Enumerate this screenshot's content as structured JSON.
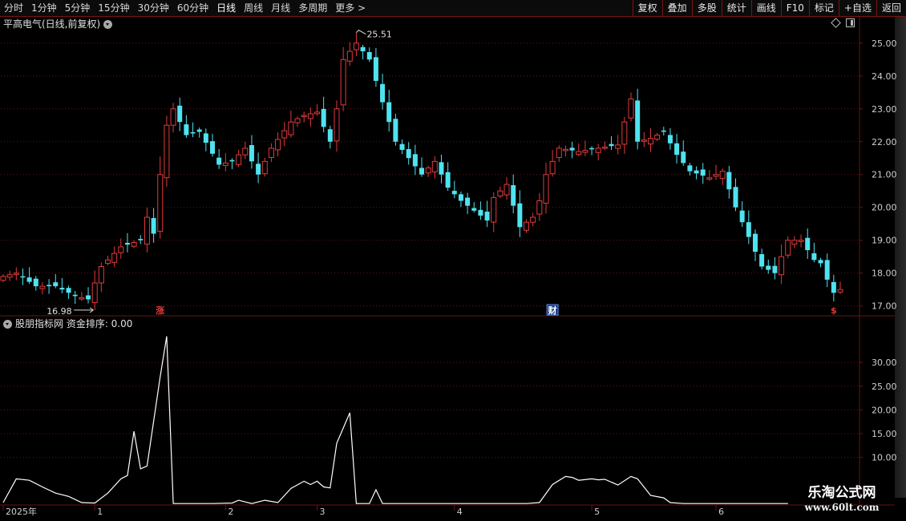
{
  "toolbar": {
    "periods": [
      "分时",
      "1分钟",
      "5分钟",
      "15分钟",
      "30分钟",
      "60分钟",
      "日线",
      "周线",
      "月线",
      "多周期",
      "更多 >"
    ],
    "active_period": "日线",
    "buttons": [
      "复权",
      "叠加",
      "多股",
      "统计",
      "画线",
      "F10",
      "标记",
      "+自选",
      "返回"
    ]
  },
  "stock": {
    "title": "平高电气(日线,前复权)"
  },
  "indicator": {
    "title": "股朋指标网 资金排序: 0.00"
  },
  "watermark": {
    "title": "乐淘公式网",
    "url": "www.60lt.com"
  },
  "colors": {
    "up": "#e23a3a",
    "down": "#4fe3f0",
    "grid": "#6a1414",
    "text": "#cfcfcf",
    "line": "#ffffff"
  },
  "chart_data": [
    {
      "type": "candlestick",
      "ylim": [
        16.7,
        25.8
      ],
      "price_ticks": [
        "25.00",
        "24.00",
        "23.00",
        "22.00",
        "21.00",
        "20.00",
        "19.00",
        "18.00",
        "17.00"
      ],
      "high_label": "25.51",
      "low_label": "16.98",
      "markers": [
        {
          "label": "涨",
          "index": 24
        },
        {
          "label": "财",
          "index": 84
        },
        {
          "label": "$",
          "index": 127
        }
      ],
      "anchors": [
        [
          0,
          17.9
        ],
        [
          2,
          18.0
        ],
        [
          5,
          17.6
        ],
        [
          8,
          17.6
        ],
        [
          11,
          17.3
        ],
        [
          13,
          17.2
        ],
        [
          15,
          18.2
        ],
        [
          18,
          18.8
        ],
        [
          21,
          19.0
        ],
        [
          22,
          19.7
        ],
        [
          23,
          19.2
        ],
        [
          24,
          21.0
        ],
        [
          25,
          22.5
        ],
        [
          26,
          23.0
        ],
        [
          28,
          22.2
        ],
        [
          30,
          22.3
        ],
        [
          33,
          21.3
        ],
        [
          35,
          21.4
        ],
        [
          37,
          21.8
        ],
        [
          39,
          21.0
        ],
        [
          41,
          21.8
        ],
        [
          44,
          22.6
        ],
        [
          46,
          22.8
        ],
        [
          48,
          22.9
        ],
        [
          50,
          22.0
        ],
        [
          51,
          23.0
        ],
        [
          52,
          24.5
        ],
        [
          54,
          25.0
        ],
        [
          56,
          24.5
        ],
        [
          58,
          23.2
        ],
        [
          60,
          22.0
        ],
        [
          62,
          21.5
        ],
        [
          64,
          21.0
        ],
        [
          66,
          21.4
        ],
        [
          68,
          20.6
        ],
        [
          70,
          20.2
        ],
        [
          72,
          19.9
        ],
        [
          74,
          19.6
        ],
        [
          75,
          20.3
        ],
        [
          77,
          20.7
        ],
        [
          79,
          19.4
        ],
        [
          81,
          19.7
        ],
        [
          82,
          20.2
        ],
        [
          83,
          21.0
        ],
        [
          85,
          21.8
        ],
        [
          88,
          21.7
        ],
        [
          91,
          21.8
        ],
        [
          94,
          21.9
        ],
        [
          96,
          23.3
        ],
        [
          97,
          22.0
        ],
        [
          99,
          22.1
        ],
        [
          101,
          22.3
        ],
        [
          103,
          21.6
        ],
        [
          105,
          21.1
        ],
        [
          108,
          20.9
        ],
        [
          110,
          21.1
        ],
        [
          112,
          20.0
        ],
        [
          114,
          19.1
        ],
        [
          116,
          18.2
        ],
        [
          118,
          18.0
        ],
        [
          120,
          19.0
        ],
        [
          122,
          19.0
        ],
        [
          124,
          18.4
        ],
        [
          125,
          18.3
        ],
        [
          126,
          17.8
        ],
        [
          127,
          17.4
        ],
        [
          128,
          17.5
        ]
      ],
      "candle_count": 129
    },
    {
      "type": "line",
      "ylim": [
        0,
        38.8
      ],
      "y_ticks": [
        "30.00",
        "25.00",
        "20.00",
        "15.00",
        "10.00"
      ],
      "y_tick_values": [
        30,
        25,
        20,
        15,
        10
      ],
      "x_labels": [
        {
          "label": "2025年",
          "index": 0
        },
        {
          "label": "1",
          "index": 14
        },
        {
          "label": "2",
          "index": 34
        },
        {
          "label": "3",
          "index": 48
        },
        {
          "label": "4",
          "index": 69
        },
        {
          "label": "5",
          "index": 90
        },
        {
          "label": "6",
          "index": 109
        }
      ],
      "points": [
        [
          0,
          0.5
        ],
        [
          2,
          5.5
        ],
        [
          4,
          5.2
        ],
        [
          6,
          3.8
        ],
        [
          8,
          2.5
        ],
        [
          10,
          1.8
        ],
        [
          12,
          0.5
        ],
        [
          14,
          0.4
        ],
        [
          16,
          2.5
        ],
        [
          18,
          5.5
        ],
        [
          19,
          6.2
        ],
        [
          20,
          15.5
        ],
        [
          21,
          7.6
        ],
        [
          22,
          8.2
        ],
        [
          24,
          27.0
        ],
        [
          25,
          35.5
        ],
        [
          26,
          0.3
        ],
        [
          28,
          0.3
        ],
        [
          32,
          0.3
        ],
        [
          35,
          0.4
        ],
        [
          36,
          1.0
        ],
        [
          38,
          0.3
        ],
        [
          40,
          1.0
        ],
        [
          42,
          0.5
        ],
        [
          44,
          3.5
        ],
        [
          46,
          5.0
        ],
        [
          47,
          4.3
        ],
        [
          48,
          5.0
        ],
        [
          49,
          3.8
        ],
        [
          50,
          3.6
        ],
        [
          51,
          13.0
        ],
        [
          53,
          19.4
        ],
        [
          54,
          0.3
        ],
        [
          56,
          0.3
        ],
        [
          57,
          3.2
        ],
        [
          58,
          0.3
        ],
        [
          80,
          0.3
        ],
        [
          82,
          0.5
        ],
        [
          84,
          4.3
        ],
        [
          86,
          6.0
        ],
        [
          87,
          5.8
        ],
        [
          88,
          5.2
        ],
        [
          90,
          5.5
        ],
        [
          91,
          5.3
        ],
        [
          92,
          5.4
        ],
        [
          94,
          4.2
        ],
        [
          96,
          6.0
        ],
        [
          97,
          5.5
        ],
        [
          99,
          2.0
        ],
        [
          101,
          1.5
        ],
        [
          102,
          0.5
        ],
        [
          104,
          0.3
        ],
        [
          120,
          0.3
        ]
      ]
    }
  ]
}
